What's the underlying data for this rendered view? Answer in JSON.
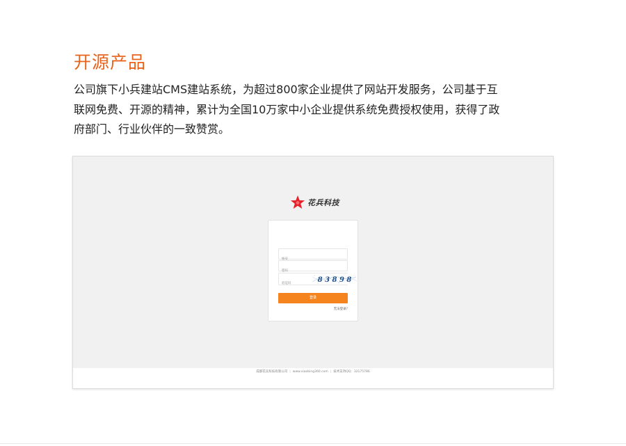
{
  "section": {
    "title": "开源产品",
    "intro_lines": [
      "公司旗下小兵建站CMS建站系统，为超过800家企业提供了网站开发服务，公司基于互",
      "联网免费、开源的精神，累计为全国10万家中小企业提供系统免费授权使用，获得了政",
      "府部门、行业伙伴的一致赞赏。"
    ]
  },
  "preview": {
    "brand": {
      "name": "花兵科技",
      "logo_icon": "red-star-logo-icon",
      "logo_color": "#e6212a"
    },
    "login": {
      "account_placeholder": "帐号",
      "password_placeholder": "密码",
      "captcha_placeholder": "验证码",
      "captcha_text": "8 3 8 9 8",
      "submit_label": "登录",
      "forgot_label": "无法登录?",
      "accent_color": "#f5841f"
    },
    "footer": {
      "company": "成都花兵科技有限公司",
      "website": "www.xiaobing360.com",
      "support": "技术支持QQ：32175786"
    }
  },
  "colors": {
    "title": "#e8641c",
    "text": "#222222",
    "preview_bg": "#f1f1f1"
  }
}
